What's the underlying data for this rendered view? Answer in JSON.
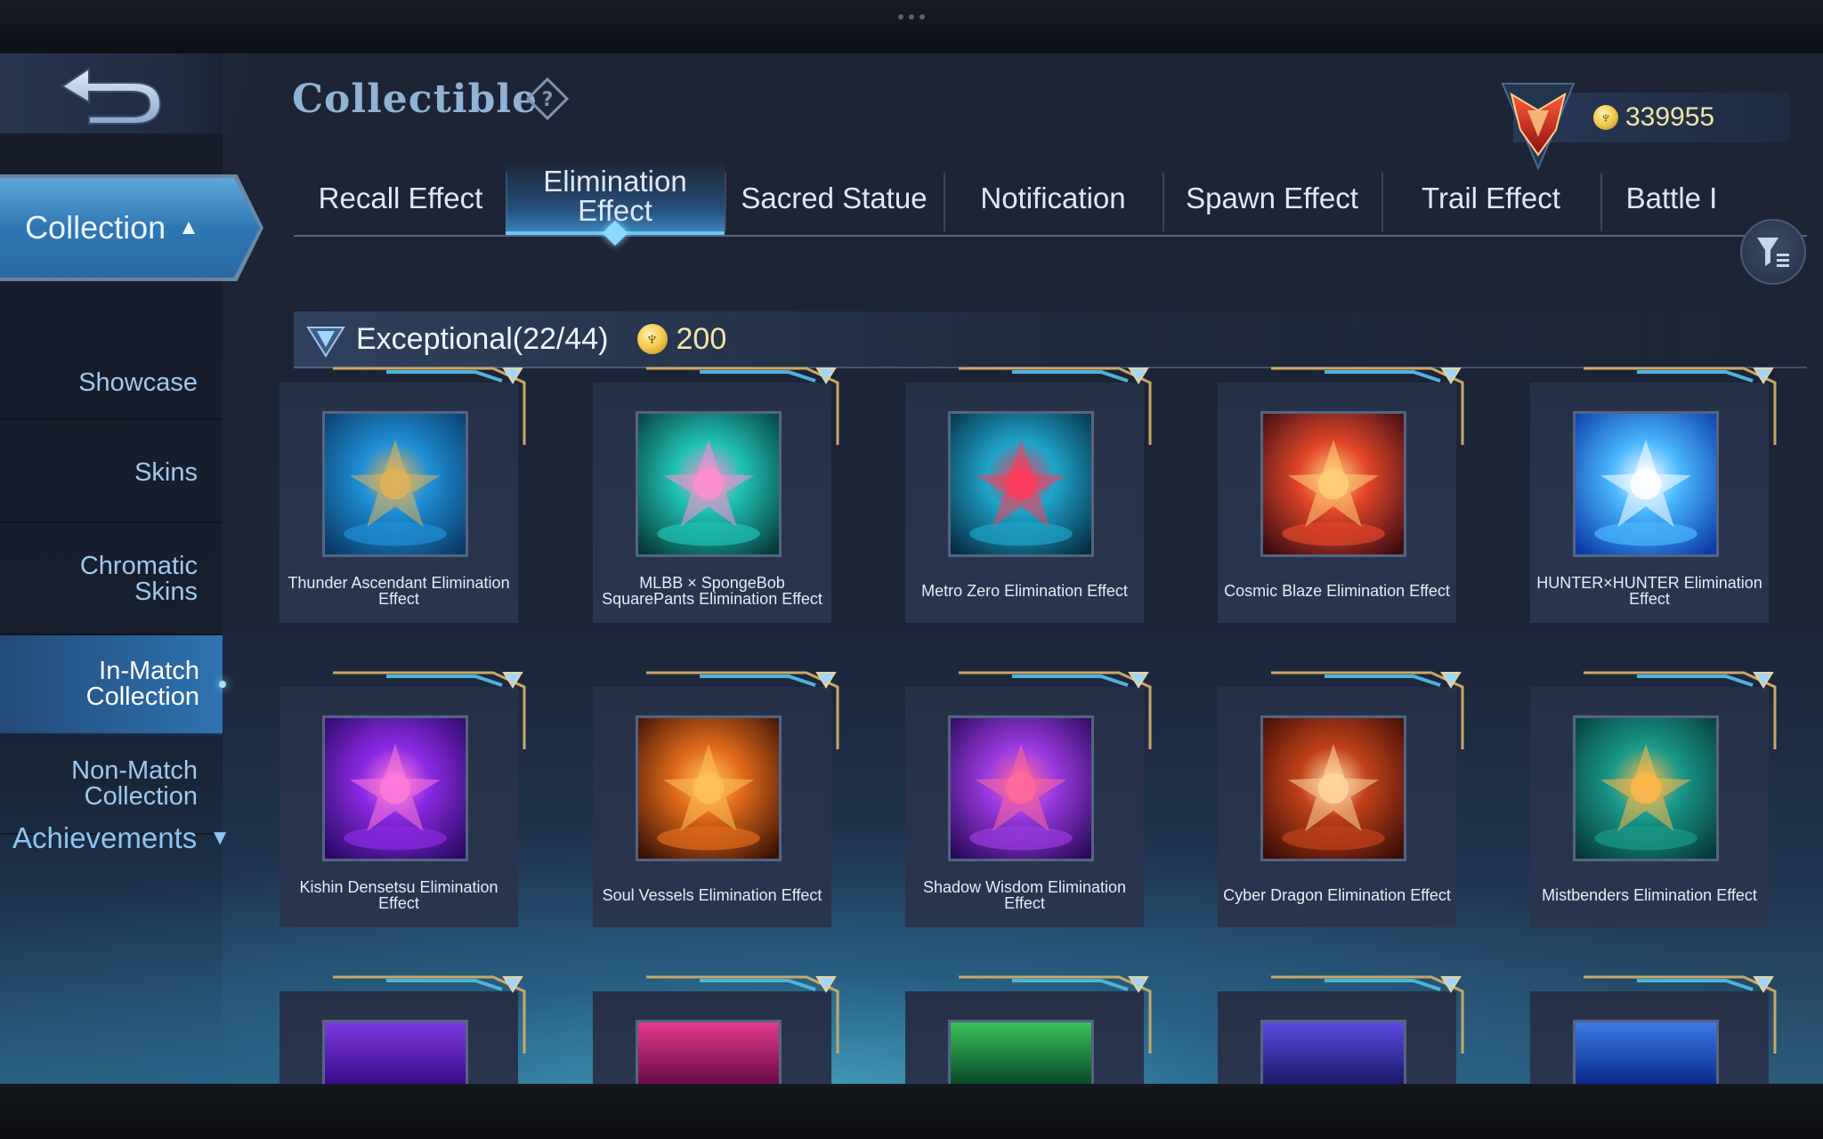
{
  "window": {
    "title": "Collectible"
  },
  "header": {
    "title": "Collectible",
    "help_icon": "question-diamond-icon",
    "currency": {
      "icon": "coin-icon",
      "value": "339955"
    }
  },
  "sidebar": {
    "collection_label": "Collection",
    "items": [
      {
        "label_lines": [
          "Showcase"
        ],
        "active": false
      },
      {
        "label_lines": [
          "Skins"
        ],
        "active": false
      },
      {
        "label_lines": [
          "Chromatic",
          "Skins"
        ],
        "active": false
      },
      {
        "label_lines": [
          "In-Match",
          "Collection"
        ],
        "active": true
      },
      {
        "label_lines": [
          "Non-Match",
          "Collection"
        ],
        "active": false
      }
    ],
    "achievements_label": "Achievements"
  },
  "tabs": [
    {
      "label": "Recall Effect",
      "active": false
    },
    {
      "label_lines": [
        "Elimination",
        "Effect"
      ],
      "active": true
    },
    {
      "label": "Sacred Statue",
      "active": false
    },
    {
      "label": "Notification",
      "active": false
    },
    {
      "label": "Spawn Effect",
      "active": false
    },
    {
      "label": "Trail Effect",
      "active": false
    },
    {
      "label": "Battle I",
      "active": false
    }
  ],
  "section": {
    "tier": "Exceptional",
    "count": "(22/44)",
    "price": "200"
  },
  "cards": [
    {
      "name": "Thunder Ascendant Elimination Effect",
      "palette": [
        "#0a3a66",
        "#1f8fd6",
        "#e2b35a"
      ]
    },
    {
      "name": "MLBB × SpongeBob SquarePants Elimination Effect",
      "palette": [
        "#063a3a",
        "#1fc2b4",
        "#ff8fd0"
      ]
    },
    {
      "name": "Metro Zero Elimination Effect",
      "palette": [
        "#062f44",
        "#1ea4c8",
        "#ff3a5a"
      ]
    },
    {
      "name": "Cosmic Blaze Elimination Effect",
      "palette": [
        "#3a0c12",
        "#e2462a",
        "#ffd07a"
      ]
    },
    {
      "name": "HUNTER×HUNTER Elimination Effect",
      "palette": [
        "#0a3aa8",
        "#4ab8ff",
        "#ffffff"
      ]
    },
    {
      "name": "Kishin Densetsu Elimination Effect",
      "palette": [
        "#2a0a66",
        "#8a2ae2",
        "#ff7ad8"
      ]
    },
    {
      "name": "Soul Vessels Elimination Effect",
      "palette": [
        "#3a1206",
        "#e26a1a",
        "#ffc25a"
      ]
    },
    {
      "name": "Shadow Wisdom Elimination Effect",
      "palette": [
        "#2a0a5a",
        "#9a3ae2",
        "#ff6a9a"
      ]
    },
    {
      "name": "Cyber Dragon Elimination Effect",
      "palette": [
        "#3a0e06",
        "#c2401a",
        "#ffd6a0"
      ]
    },
    {
      "name": "Mistbenders Elimination Effect",
      "palette": [
        "#063a3a",
        "#1a9a8a",
        "#ffb84a"
      ]
    }
  ],
  "partial_row_palettes": [
    [
      "#3a0a8a",
      "#7a3ae2"
    ],
    [
      "#6a0a4a",
      "#e23a8a"
    ],
    [
      "#0a4a2a",
      "#3ac25a"
    ],
    [
      "#1a1a6a",
      "#5a4ae2"
    ],
    [
      "#0a2a8a",
      "#3a7ae2"
    ]
  ],
  "colors": {
    "accent": "#6cc8f0",
    "active_sidebar": "#2e73b0",
    "gold": "#f3e4a6"
  }
}
